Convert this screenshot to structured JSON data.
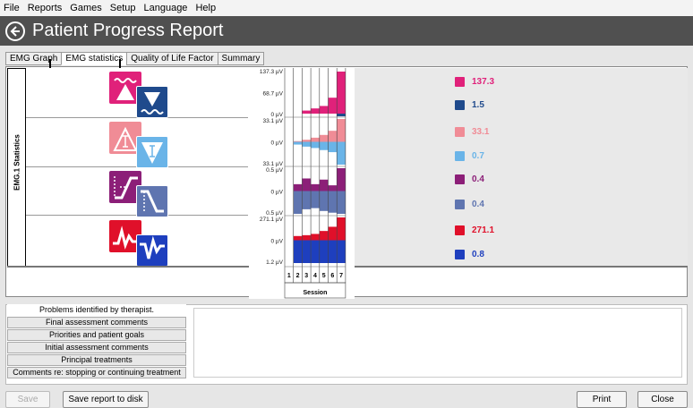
{
  "menu": [
    "File",
    "Reports",
    "Games",
    "Setup",
    "Language",
    "Help"
  ],
  "header": {
    "title": "Patient Progress Report"
  },
  "tabs": [
    "EMG Graph",
    "EMG statistics",
    "Quality of Life Factor",
    "Summary"
  ],
  "side_label": "EMG.1 Statistics",
  "chart_data": {
    "type": "bar",
    "categories": [
      "1",
      "2",
      "3",
      "4",
      "5",
      "6",
      "7"
    ],
    "xlabel": "Session",
    "rows": [
      {
        "name": "row1",
        "ticks": [
          "137.3 µV",
          "68.7 µV",
          "0 µV"
        ],
        "series": [
          {
            "name": "max",
            "color": "#e0217a",
            "values": [
              0,
              0,
              10,
              17,
              25,
              52,
              137.3
            ]
          },
          {
            "name": "min",
            "color": "#1f4a8c",
            "values": [
              0,
              0,
              0,
              0,
              0,
              0,
              1.5
            ]
          }
        ]
      },
      {
        "name": "row2",
        "ticks": [
          "33.1 µV",
          "0 µV",
          "33.1 µV"
        ],
        "series": [
          {
            "name": "inc",
            "color": "#f08c96",
            "values": [
              0,
              1,
              3,
              6,
              10,
              16,
              33.1
            ]
          },
          {
            "name": "dec",
            "color": "#6ab4e8",
            "values": [
              0,
              -4,
              -7,
              -9,
              -12,
              -15,
              -33.1
            ]
          }
        ]
      },
      {
        "name": "row3",
        "ticks": [
          "0.5 µV",
          "0 µV",
          "0.5 µV"
        ],
        "series": [
          {
            "name": "up",
            "color": "#8c1f78",
            "values": [
              0,
              0.12,
              0.22,
              0.12,
              0.2,
              0.1,
              0.4
            ]
          },
          {
            "name": "down",
            "color": "#5f75b0",
            "values": [
              0,
              -0.4,
              -0.32,
              -0.3,
              -0.35,
              -0.38,
              -0.4
            ]
          }
        ]
      },
      {
        "name": "row4",
        "ticks": [
          "271.1 µV",
          "0 µV",
          "1.2 µV"
        ],
        "series": [
          {
            "name": "peak",
            "color": "#e0102a",
            "values": [
              0,
              50,
              60,
              75,
              110,
              160,
              271.1
            ]
          },
          {
            "name": "low",
            "color": "#1e3fbe",
            "values": [
              0,
              -1.2,
              -1.2,
              -1.2,
              -1.2,
              -1.2,
              -1.2
            ]
          }
        ]
      }
    ]
  },
  "legend": [
    {
      "value": "137.3",
      "color": "#e0217a",
      "icon": "max-contraction-icon"
    },
    {
      "value": "1.5",
      "color": "#1f4a8c",
      "icon": "min-contraction-icon"
    },
    {
      "value": "33.1",
      "color": "#f08c96",
      "icon": "increase-triangle-icon"
    },
    {
      "value": "0.7",
      "color": "#6ab4e8",
      "icon": "decrease-triangle-icon"
    },
    {
      "value": "0.4",
      "color": "#8c1f78",
      "icon": "ramp-up-icon"
    },
    {
      "value": "0.4",
      "color": "#5f75b0",
      "icon": "ramp-down-icon"
    },
    {
      "value": "271.1",
      "color": "#e0102a",
      "icon": "peak-icon"
    },
    {
      "value": "0.8",
      "color": "#1e3fbe",
      "icon": "valley-icon"
    }
  ],
  "notes": [
    "Problems identified by therapist.",
    "Final assessment comments",
    "Priorities and patient goals",
    "Initial assessment comments",
    "Principal treatments",
    "Comments re: stopping or continuing treatment"
  ],
  "buttons": {
    "save": "Save",
    "save_disk": "Save report to disk",
    "print": "Print",
    "close": "Close"
  }
}
